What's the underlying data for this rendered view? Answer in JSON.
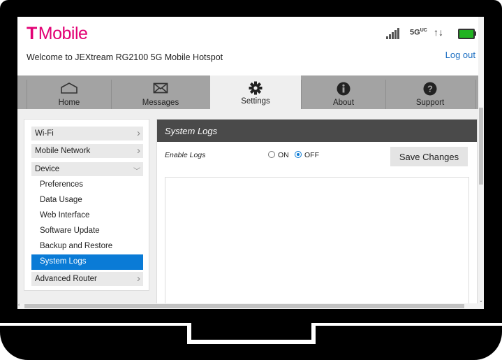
{
  "header": {
    "brand": "Mobile",
    "brand_mark": "T",
    "welcome": "Welcome to JEXtream RG2100 5G Mobile Hotspot",
    "logout": "Log out",
    "network_label": "5G",
    "network_sub": "UC",
    "status_icons": [
      "signal-icon",
      "5g-uc-icon",
      "data-transfer-icon",
      "battery-icon"
    ]
  },
  "tabs": [
    {
      "label": "Home",
      "icon": "home-icon"
    },
    {
      "label": "Messages",
      "icon": "envelope-icon"
    },
    {
      "label": "Settings",
      "icon": "gear-icon",
      "active": true
    },
    {
      "label": "About",
      "icon": "info-icon"
    },
    {
      "label": "Support",
      "icon": "help-icon"
    }
  ],
  "sidebar": {
    "items": [
      {
        "label": "Wi-Fi"
      },
      {
        "label": "Mobile Network"
      },
      {
        "label": "Device",
        "expanded": true
      },
      {
        "label": "Advanced Router"
      }
    ],
    "device_subitems": [
      {
        "label": "Preferences"
      },
      {
        "label": "Data Usage"
      },
      {
        "label": "Web Interface"
      },
      {
        "label": "Software Update"
      },
      {
        "label": "Backup and Restore"
      },
      {
        "label": "System Logs",
        "selected": true
      }
    ]
  },
  "panel": {
    "title": "System Logs",
    "enable_label": "Enable Logs",
    "on_label": "ON",
    "off_label": "OFF",
    "selected": "OFF",
    "save_label": "Save Changes"
  },
  "colors": {
    "brand": "#e20074",
    "accent": "#0a7bd6",
    "panel_header": "#4a4a4a",
    "tabbar": "#a3a3a3"
  }
}
